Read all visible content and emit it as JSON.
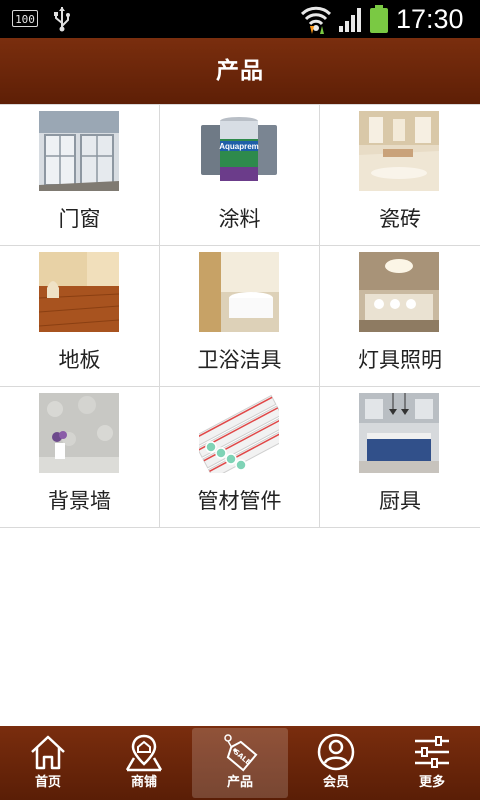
{
  "status_bar": {
    "battery_text": "100",
    "time": "17:30",
    "icons": [
      "battery-level-icon",
      "usb-icon",
      "wifi-icon",
      "signal-icon",
      "battery-icon"
    ],
    "battery_color": "#7ac943"
  },
  "header": {
    "title": "产品",
    "background": "#6b250a"
  },
  "categories": [
    {
      "label": "门窗",
      "image": "windows-image"
    },
    {
      "label": "涂料",
      "image": "paint-image"
    },
    {
      "label": "瓷砖",
      "image": "tile-image"
    },
    {
      "label": "地板",
      "image": "floor-image"
    },
    {
      "label": "卫浴洁具",
      "image": "bathroom-image"
    },
    {
      "label": "灯具照明",
      "image": "lighting-image"
    },
    {
      "label": "背景墙",
      "image": "wall-image"
    },
    {
      "label": "管材管件",
      "image": "pipe-image"
    },
    {
      "label": "厨具",
      "image": "kitchen-image"
    }
  ],
  "paint_can_text": "Aquaprem",
  "tabs": [
    {
      "label": "首页",
      "icon": "home-icon",
      "active": false
    },
    {
      "label": "商铺",
      "icon": "store-map-icon",
      "active": false
    },
    {
      "label": "产品",
      "icon": "sale-tag-icon",
      "active": true
    },
    {
      "label": "会员",
      "icon": "user-icon",
      "active": false
    },
    {
      "label": "更多",
      "icon": "settings-sliders-icon",
      "active": false
    }
  ],
  "sale_tag_text": "SALE"
}
